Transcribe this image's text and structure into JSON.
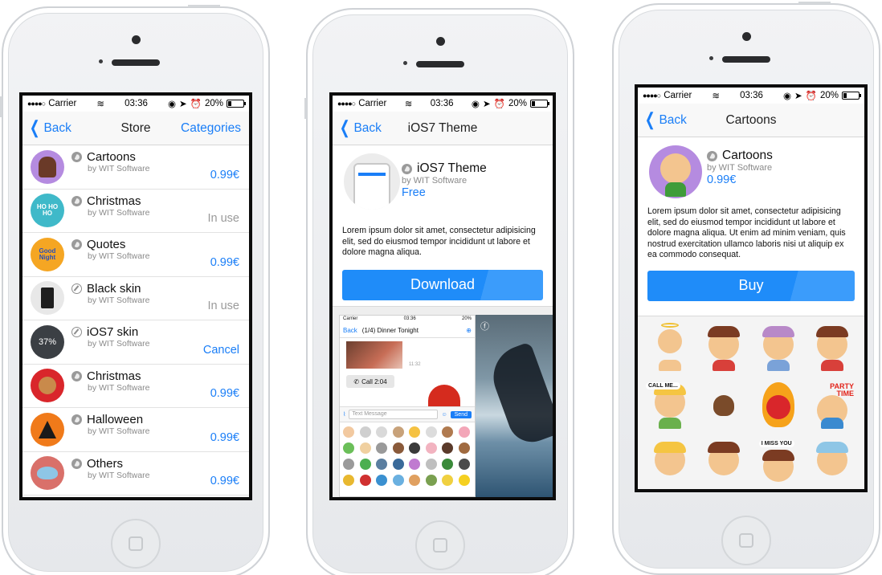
{
  "status": {
    "carrier": "Carrier",
    "time": "03:36",
    "battery": "20%",
    "battery_level": 0.2
  },
  "phone1": {
    "nav": {
      "back": "Back",
      "title": "Store",
      "right": "Categories"
    },
    "items": [
      {
        "name": "Cartoons",
        "by": "by WIT Software",
        "action": "0.99€",
        "icon": "badge-icon",
        "color": "#b58be0"
      },
      {
        "name": "Christmas",
        "by": "by WIT Software",
        "action": "In use",
        "icon": "badge-icon",
        "color": "#3fb9c9"
      },
      {
        "name": "Quotes",
        "by": "by WIT Software",
        "action": "0.99€",
        "icon": "badge-icon",
        "color": "#f5a623"
      },
      {
        "name": "Black skin",
        "by": "by WIT Software",
        "action": "In use",
        "icon": "compass-icon",
        "color": "#e8e8e8"
      },
      {
        "name": "iOS7 skin",
        "by": "by WIT Software",
        "action": "Cancel",
        "icon": "compass-icon",
        "color": "#3b3f44",
        "progress_label": "37%"
      },
      {
        "name": "Christmas",
        "by": "by WIT Software",
        "action": "0.99€",
        "icon": "badge-icon",
        "color": "#d9262b"
      },
      {
        "name": "Halloween",
        "by": "by WIT Software",
        "action": "0.99€",
        "icon": "badge-icon",
        "color": "#f07a1a"
      },
      {
        "name": "Others",
        "by": "by WIT Software",
        "action": "0.99€",
        "icon": "badge-icon",
        "color": "#d9706a"
      }
    ],
    "thumb_labels": {
      "christmas": "HO HO HO",
      "quotes": "Good Night"
    }
  },
  "phone2": {
    "nav": {
      "back": "Back",
      "title": "iOS7 Theme"
    },
    "name": "iOS7 Theme",
    "by": "by WIT Software",
    "price": "Free",
    "description": "Lorem ipsum dolor sit amet, consectetur adipisicing elit, sed do eiusmod tempor incididunt ut labore et dolore magna aliqua.",
    "button": "Download",
    "preview": {
      "carrier": "Carrier",
      "time": "03:36",
      "battery": "20%",
      "back": "Back",
      "title": "(1/4) Dinner Tonight",
      "timestamp": "11:32",
      "call": "Call 2:04",
      "input_placeholder": "Text Message",
      "send": "Send"
    }
  },
  "phone3": {
    "nav": {
      "back": "Back",
      "title": "Cartoons"
    },
    "name": "Cartoons",
    "by": "by WIT Software",
    "price": "0.99€",
    "description": "Lorem ipsum dolor sit amet, consectetur adipisicing elit, sed do eiusmod tempor incididunt ut labore et dolore magna aliqua. Ut enim ad minim veniam, quis nostrud exercitation ullamco laboris nisi ut aliquip ex ea commodo consequat.",
    "button": "Buy",
    "sticker_texts": {
      "call_me": "CALL ME...",
      "party": "PARTY TIME",
      "miss": "I MISS YOU"
    }
  },
  "colors": {
    "accent": "#1a7ef7",
    "muted": "#9a9a9a",
    "button": "#1f8cf9"
  }
}
